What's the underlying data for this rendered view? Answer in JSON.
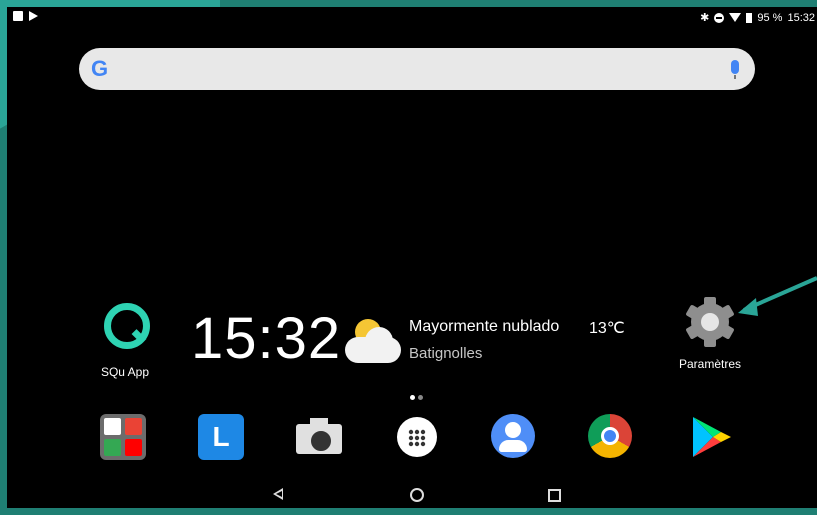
{
  "status_bar": {
    "battery": "95 %",
    "time": "15:32"
  },
  "search": {
    "logo": "G"
  },
  "apps": {
    "squ_label": "SQu App",
    "settings_label": "Paramètres"
  },
  "clock": {
    "time": "15:32"
  },
  "weather": {
    "description": "Mayormente nublado",
    "temperature": "13℃",
    "location": "Batignolles"
  },
  "dock": {
    "lens_letter": "L",
    "icons": [
      "google-apps-folder-icon",
      "lens-icon",
      "camera-icon",
      "app-drawer-icon",
      "contacts-icon",
      "chrome-icon",
      "play-store-icon"
    ]
  },
  "colors": {
    "frame_teal": "#1f7f73",
    "squ_accent": "#2ed3b3",
    "annotation_arrow": "#2aa597"
  }
}
